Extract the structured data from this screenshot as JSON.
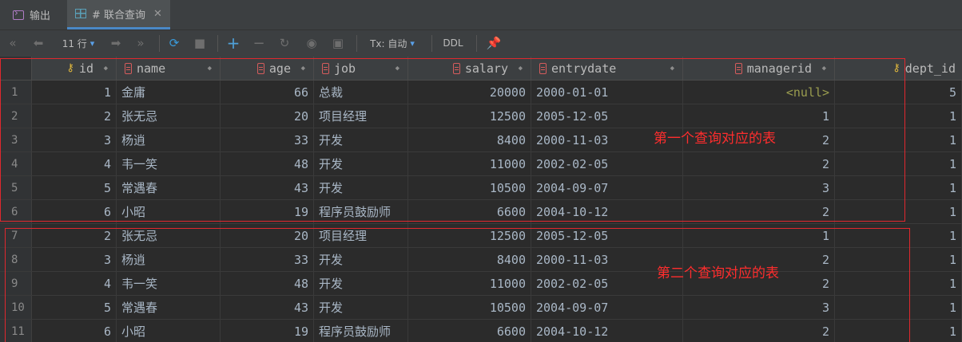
{
  "tabs": [
    {
      "label": "输出",
      "icon": "console-icon"
    },
    {
      "label": "# 联合查询",
      "icon": "table-icon",
      "active": true
    }
  ],
  "toolbar": {
    "rows_label": "11 行",
    "tx_label": "Tx: 自动",
    "ddl_label": "DDL"
  },
  "grid": {
    "columns": [
      "id",
      "name",
      "age",
      "job",
      "salary",
      "entrydate",
      "managerid",
      "dept_id"
    ],
    "rows": [
      {
        "n": "1",
        "id": "1",
        "name": "金庸",
        "age": "66",
        "job": "总裁",
        "salary": "20000",
        "entrydate": "2000-01-01",
        "managerid": "<null>",
        "dept_id": "5"
      },
      {
        "n": "2",
        "id": "2",
        "name": "张无忌",
        "age": "20",
        "job": "项目经理",
        "salary": "12500",
        "entrydate": "2005-12-05",
        "managerid": "1",
        "dept_id": "1"
      },
      {
        "n": "3",
        "id": "3",
        "name": "杨逍",
        "age": "33",
        "job": "开发",
        "salary": "8400",
        "entrydate": "2000-11-03",
        "managerid": "2",
        "dept_id": "1"
      },
      {
        "n": "4",
        "id": "4",
        "name": "韦一笑",
        "age": "48",
        "job": "开发",
        "salary": "11000",
        "entrydate": "2002-02-05",
        "managerid": "2",
        "dept_id": "1"
      },
      {
        "n": "5",
        "id": "5",
        "name": "常遇春",
        "age": "43",
        "job": "开发",
        "salary": "10500",
        "entrydate": "2004-09-07",
        "managerid": "3",
        "dept_id": "1"
      },
      {
        "n": "6",
        "id": "6",
        "name": "小昭",
        "age": "19",
        "job": "程序员鼓励师",
        "salary": "6600",
        "entrydate": "2004-10-12",
        "managerid": "2",
        "dept_id": "1"
      },
      {
        "n": "7",
        "id": "2",
        "name": "张无忌",
        "age": "20",
        "job": "项目经理",
        "salary": "12500",
        "entrydate": "2005-12-05",
        "managerid": "1",
        "dept_id": "1"
      },
      {
        "n": "8",
        "id": "3",
        "name": "杨逍",
        "age": "33",
        "job": "开发",
        "salary": "8400",
        "entrydate": "2000-11-03",
        "managerid": "2",
        "dept_id": "1"
      },
      {
        "n": "9",
        "id": "4",
        "name": "韦一笑",
        "age": "48",
        "job": "开发",
        "salary": "11000",
        "entrydate": "2002-02-05",
        "managerid": "2",
        "dept_id": "1"
      },
      {
        "n": "10",
        "id": "5",
        "name": "常遇春",
        "age": "43",
        "job": "开发",
        "salary": "10500",
        "entrydate": "2004-09-07",
        "managerid": "3",
        "dept_id": "1"
      },
      {
        "n": "11",
        "id": "6",
        "name": "小昭",
        "age": "19",
        "job": "程序员鼓励师",
        "salary": "6600",
        "entrydate": "2004-10-12",
        "managerid": "2",
        "dept_id": "1"
      }
    ]
  },
  "annotations": [
    {
      "text": "第一个查询对应的表"
    },
    {
      "text": "第二个查询对应的表"
    }
  ],
  "colors": {
    "annotation": "#e0282e",
    "null_value": "#9a9d4f"
  }
}
